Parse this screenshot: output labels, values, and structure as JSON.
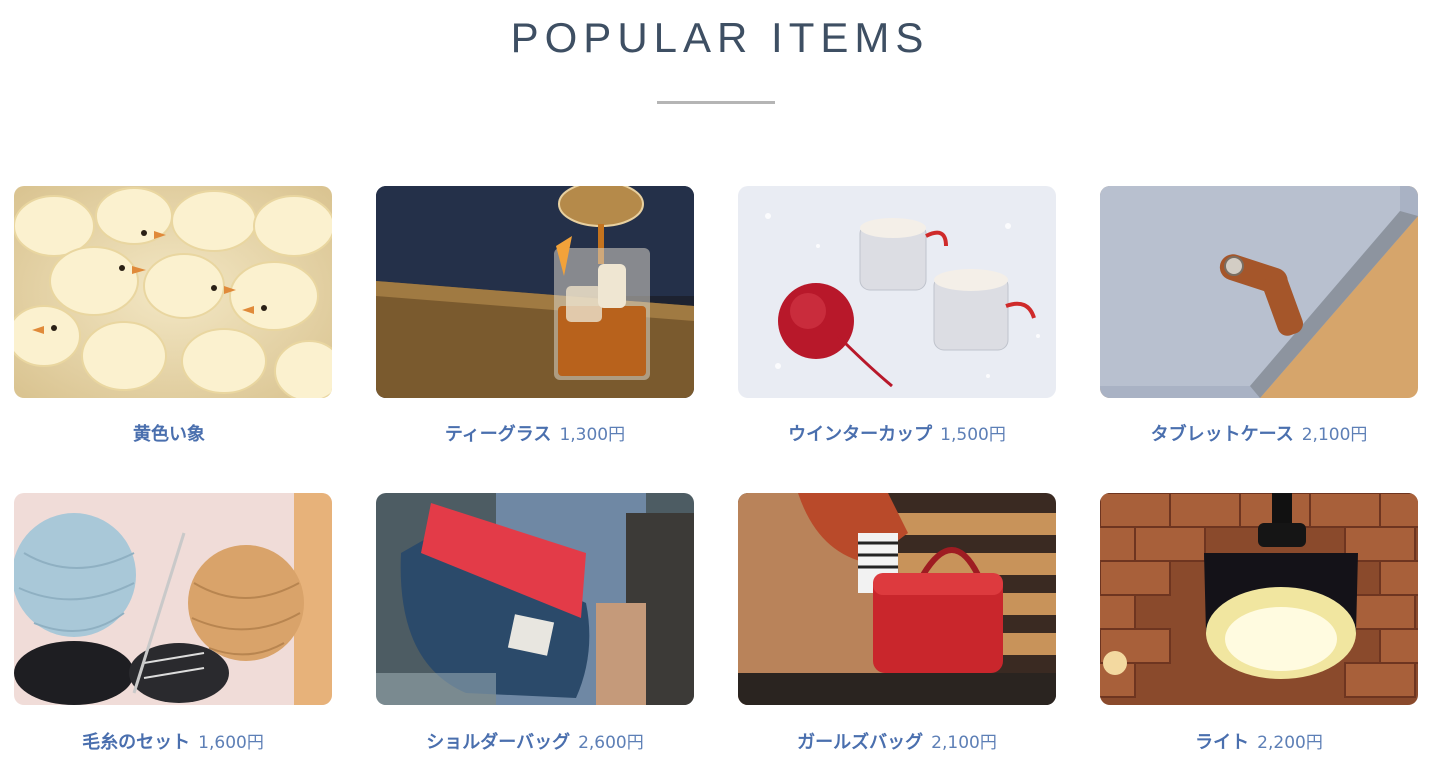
{
  "section": {
    "title": "POPULAR ITEMS"
  },
  "items": [
    {
      "name": "黄色い象",
      "price": "",
      "image_icon": "chicks-photo"
    },
    {
      "name": "ティーグラス",
      "price": "1,300円",
      "image_icon": "whisky-glass-photo"
    },
    {
      "name": "ウインターカップ",
      "price": "1,500円",
      "image_icon": "winter-cups-photo"
    },
    {
      "name": "タブレットケース",
      "price": "2,100円",
      "image_icon": "tablet-case-photo"
    },
    {
      "name": "毛糸のセット",
      "price": "1,600円",
      "image_icon": "yarn-photo"
    },
    {
      "name": "ショルダーバッグ",
      "price": "2,600円",
      "image_icon": "shoulder-bag-photo"
    },
    {
      "name": "ガールズバッグ",
      "price": "2,100円",
      "image_icon": "red-handbag-photo"
    },
    {
      "name": "ライト",
      "price": "2,200円",
      "image_icon": "pendant-lamp-photo"
    }
  ],
  "colors": {
    "title": "#3e4f63",
    "item_name": "#4a6fae",
    "item_price": "#5d7fb6",
    "rule": "#b5b5b5"
  }
}
